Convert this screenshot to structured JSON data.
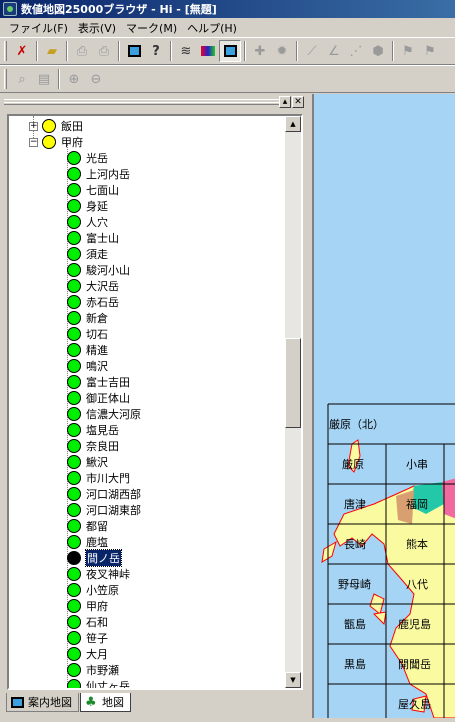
{
  "window": {
    "title": "数値地図25000ブラウザ - Hi - [無題]"
  },
  "menu": [
    "ファイル(F)",
    "表示(V)",
    "マーク(M)",
    "ヘルプ(H)"
  ],
  "toolbar1_icons": [
    "cut-icon",
    "open-folder-icon",
    "print-preview-icon",
    "print-icon",
    "frame-icon",
    "help-icon",
    "layers-icon",
    "color-icon",
    "map-view-icon",
    "crosshair-icon",
    "gear-icon",
    "line-tool-icon",
    "slope-tool-icon",
    "measure-icon",
    "area-icon",
    "flag-icon",
    "flag-number-icon"
  ],
  "toolbar2_icons": [
    "zoom-area-icon",
    "scale-icon",
    "zoom-in-icon",
    "zoom-out-icon"
  ],
  "tree": {
    "parents": [
      {
        "label": "飯田",
        "expanded": false
      },
      {
        "label": "甲府",
        "expanded": true
      }
    ],
    "children": [
      "光岳",
      "上河内岳",
      "七面山",
      "身延",
      "人穴",
      "富士山",
      "須走",
      "駿河小山",
      "大沢岳",
      "赤石岳",
      "新倉",
      "切石",
      "精進",
      "鳴沢",
      "富士吉田",
      "御正体山",
      "信濃大河原",
      "塩見岳",
      "奈良田",
      "鰍沢",
      "市川大門",
      "河口湖西部",
      "河口湖東部",
      "都留",
      "鹿塩",
      "間ノ岳",
      "夜叉神峠",
      "小笠原",
      "甲府",
      "石和",
      "笹子",
      "大月",
      "市野瀬",
      "仙丈ヶ岳"
    ],
    "selected": "間ノ岳"
  },
  "tabs": [
    {
      "label": "案内地図",
      "active": false
    },
    {
      "label": "地図",
      "active": true
    }
  ],
  "map": {
    "cells": [
      "厳原（北）",
      "厳原",
      "小串",
      "唐津",
      "福岡",
      "長崎",
      "熊本",
      "野母崎",
      "八代",
      "甑島",
      "鹿児島",
      "黒島",
      "開聞岳",
      "屋久島"
    ],
    "colors": {
      "sea": "#a6d4f5",
      "land": "#fafaa0",
      "teal": "#22c8a8",
      "pink": "#f06aa0",
      "border": "#ff0000"
    }
  }
}
